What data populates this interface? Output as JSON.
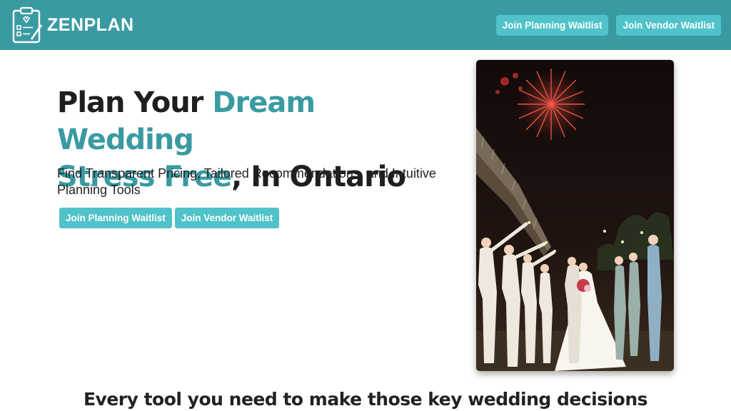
{
  "header": {
    "brand": "ZENPLAN",
    "buttons": {
      "planning": "Join Planning Waitlist",
      "vendor": "Join Vendor Waitlist"
    }
  },
  "hero": {
    "title": {
      "part1": "Plan Your ",
      "highlight1": "Dream Wedding",
      "highlight2": "Stress Free",
      "part2": ", In Ontario"
    },
    "subtitle": "Find Transparent Pricing, Tailored Recommendations, and Intuitive Planning Tools",
    "buttons": {
      "planning": "Join Planning Waitlist",
      "vendor": "Join Vendor Waitlist"
    }
  },
  "features": {
    "heading": "Every tool you need to make those key wedding decisions"
  },
  "colors": {
    "brand": "#3a9aa2",
    "button": "#4fc3c9"
  }
}
